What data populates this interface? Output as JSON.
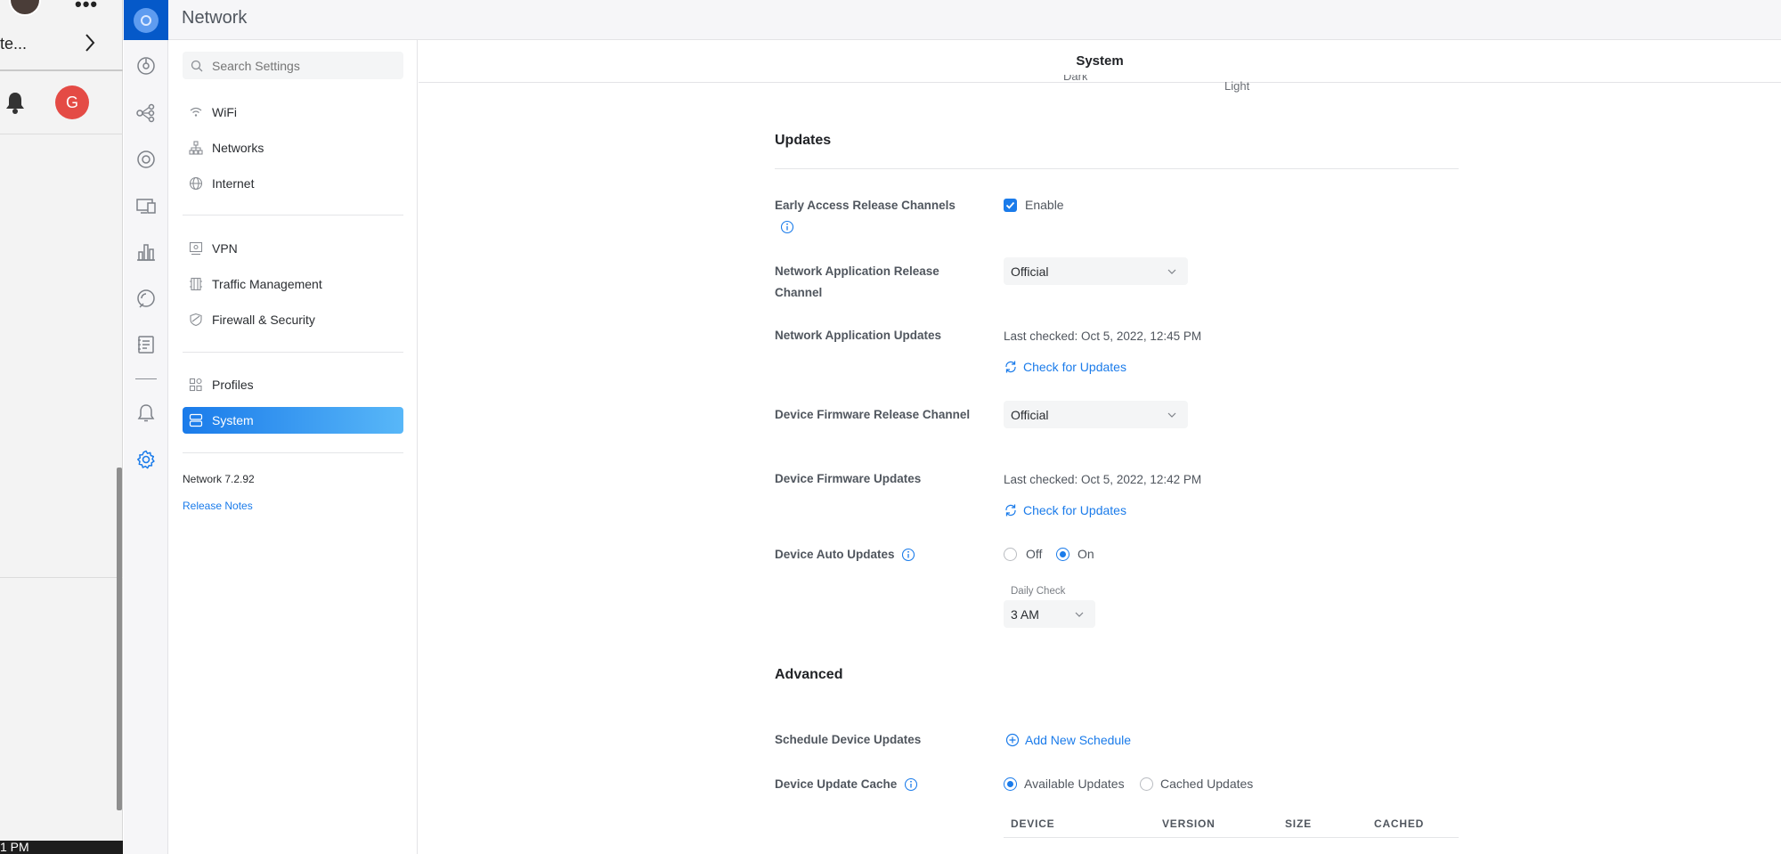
{
  "os": {
    "app_text": "te...",
    "dots": "•••",
    "user_initial": "G",
    "taskbar_text": "1 PM"
  },
  "app": {
    "title": "Network"
  },
  "search": {
    "placeholder": "Search Settings"
  },
  "sidebar": {
    "items": [
      {
        "label": "WiFi",
        "icon": "wifi-icon"
      },
      {
        "label": "Networks",
        "icon": "networks-icon"
      },
      {
        "label": "Internet",
        "icon": "globe-icon"
      },
      {
        "label": "VPN",
        "icon": "vpn-icon"
      },
      {
        "label": "Traffic Management",
        "icon": "traffic-icon"
      },
      {
        "label": "Firewall & Security",
        "icon": "shield-icon"
      },
      {
        "label": "Profiles",
        "icon": "profiles-icon"
      },
      {
        "label": "System",
        "icon": "system-icon",
        "active": true
      }
    ],
    "version": "Network 7.2.92",
    "release_notes": "Release Notes"
  },
  "header": {
    "title": "System"
  },
  "theme": {
    "dark_label": "Dark",
    "light_label": "Light"
  },
  "updates": {
    "title": "Updates",
    "early_access": {
      "label": "Early Access Release Channels",
      "checkbox_label": "Enable",
      "checked": true
    },
    "app_release_channel": {
      "label": "Network Application Release Channel",
      "value": "Official"
    },
    "app_updates": {
      "label": "Network Application Updates",
      "last_checked": "Last checked: Oct 5, 2022, 12:45 PM",
      "check_link": "Check for Updates"
    },
    "fw_release_channel": {
      "label": "Device Firmware Release Channel",
      "value": "Official"
    },
    "fw_updates": {
      "label": "Device Firmware Updates",
      "last_checked": "Last checked: Oct 5, 2022, 12:42 PM",
      "check_link": "Check for Updates"
    },
    "auto_updates": {
      "label": "Device Auto Updates",
      "off_label": "Off",
      "on_label": "On",
      "selected": "On",
      "daily_check_label": "Daily Check",
      "daily_check_value": "3 AM"
    }
  },
  "advanced": {
    "title": "Advanced",
    "schedule": {
      "label": "Schedule Device Updates",
      "link": "Add New Schedule"
    },
    "cache": {
      "label": "Device Update Cache",
      "option_available": "Available Updates",
      "option_cached": "Cached Updates",
      "selected": "Available Updates"
    },
    "table_headers": [
      "DEVICE",
      "VERSION",
      "SIZE",
      "CACHED"
    ]
  },
  "colors": {
    "accent": "#1a7bea",
    "brand": "#0559c9",
    "avatar": "#e44b45"
  }
}
